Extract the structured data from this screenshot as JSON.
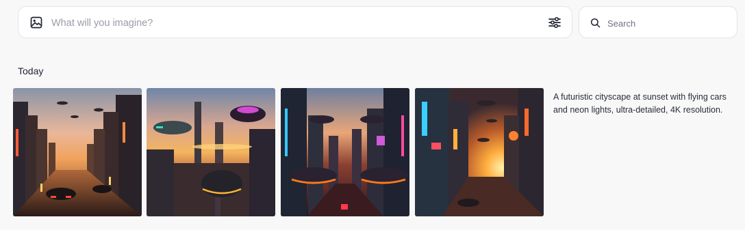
{
  "prompt_bar": {
    "placeholder": "What will you imagine?",
    "icon": "image-icon",
    "settings_icon": "sliders-icon"
  },
  "search": {
    "placeholder": "Search",
    "icon": "search-icon"
  },
  "section": {
    "title": "Today"
  },
  "generation": {
    "prompt": "A futuristic cityscape at sunset with flying cars and neon lights, ultra-detailed, 4K resolution.",
    "images": [
      {
        "alt": "futuristic-city-street-sunset"
      },
      {
        "alt": "flying-cars-over-city-sunset"
      },
      {
        "alt": "flying-cars-neon-avenue"
      },
      {
        "alt": "neon-city-sunset-alley"
      }
    ]
  },
  "colors": {
    "background": "#f8f8f9",
    "card": "#ffffff",
    "border": "#e3e4e8",
    "placeholder": "#9a9ca6",
    "text": "#1f2330"
  }
}
